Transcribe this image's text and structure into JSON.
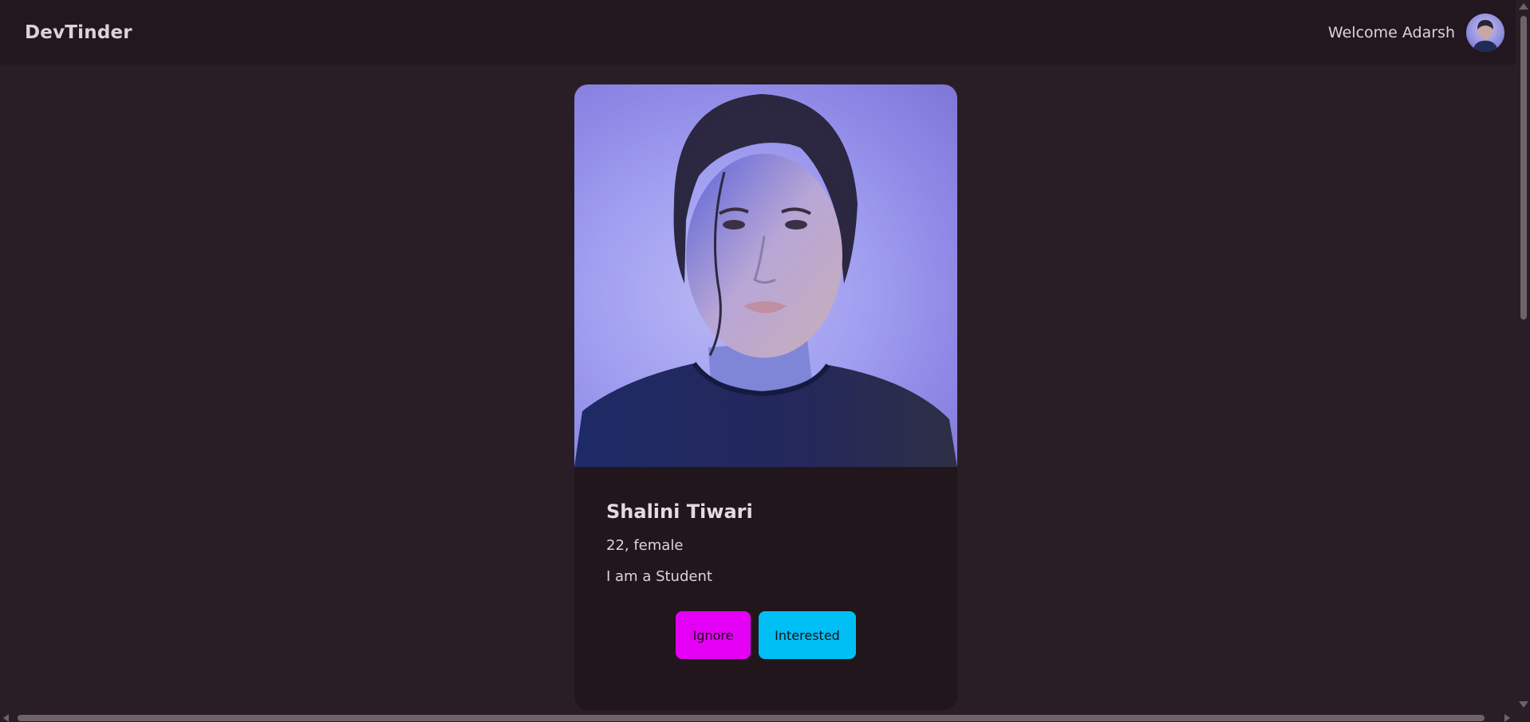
{
  "navbar": {
    "brand": "DevTinder",
    "welcome_text": "Welcome Adarsh",
    "avatar_icon": "user-avatar-photo"
  },
  "feed_card": {
    "photo_icon": "profile-photo",
    "name": "Shalini Tiwari",
    "meta": "22, female",
    "about": "I am a Student",
    "buttons": {
      "ignore_label": "Ignore",
      "interested_label": "Interested"
    }
  },
  "colors": {
    "background": "#2a1e26",
    "navbar": "#22171e",
    "card": "#21161c",
    "ignore_button": "#e300f4",
    "interested_button": "#00bff5"
  }
}
